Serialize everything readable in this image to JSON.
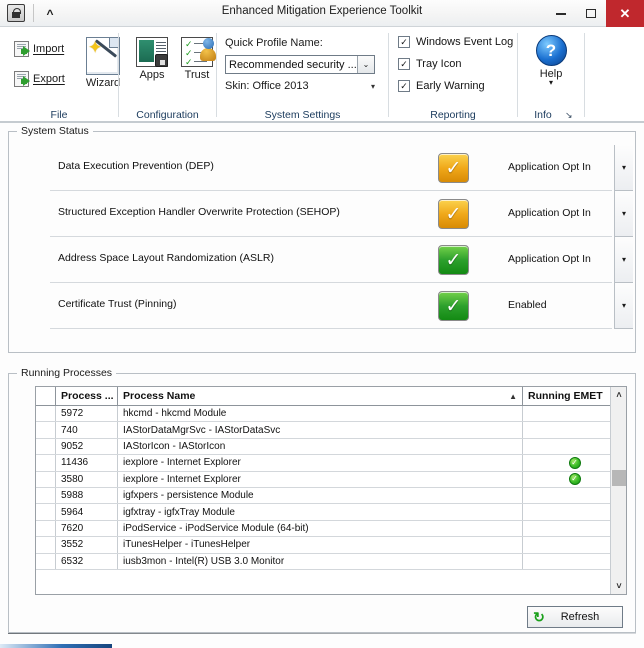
{
  "window": {
    "title": "Enhanced Mitigation Experience Toolkit",
    "app_icon": "lock-icon",
    "quick_access_caret": "^",
    "minimize": "minimize-icon",
    "maximize": "maximize-icon",
    "close": "✕"
  },
  "ribbon": {
    "groups": [
      {
        "label": "File"
      },
      {
        "label": "Configuration"
      },
      {
        "label": "System Settings"
      },
      {
        "label": "Reporting"
      },
      {
        "label": "Info"
      }
    ],
    "file": {
      "import_label": "Import",
      "export_label": "Export",
      "wizard_label": "Wizard"
    },
    "configuration": {
      "apps_label": "Apps",
      "trust_label": "Trust"
    },
    "system_settings": {
      "profile_caption": "Quick Profile Name:",
      "profile_value": "Recommended security ...",
      "profile_arrow": "⌄",
      "skin_label": "Skin: Office 2013",
      "skin_arrow": "▾"
    },
    "reporting": {
      "checkboxes": [
        {
          "label": "Windows Event Log",
          "checked": true,
          "mark": "✓"
        },
        {
          "label": "Tray Icon",
          "checked": true,
          "mark": "✓"
        },
        {
          "label": "Early Warning",
          "checked": true,
          "mark": "✓"
        }
      ]
    },
    "info": {
      "help_label": "Help",
      "help_glyph": "?",
      "help_dropdown": "▾",
      "dialog_launcher": "↘"
    }
  },
  "system_status": {
    "caption": "System Status",
    "rows": [
      {
        "name": "Data Execution Prevention (DEP)",
        "value": "Application Opt In",
        "icon": "check-amber-icon",
        "icon_color": "#f0a81a",
        "dropdown": "▾"
      },
      {
        "name": "Structured Exception Handler Overwrite Protection (SEHOP)",
        "value": "Application Opt In",
        "icon": "check-amber-icon",
        "icon_color": "#f0a81a",
        "dropdown": "▾"
      },
      {
        "name": "Address Space Layout Randomization (ASLR)",
        "value": "Application Opt In",
        "icon": "check-green-icon",
        "icon_color": "#2da02d",
        "dropdown": "▾"
      },
      {
        "name": "Certificate Trust (Pinning)",
        "value": "Enabled",
        "icon": "check-green-icon",
        "icon_color": "#2da02d",
        "dropdown": "▾"
      }
    ]
  },
  "running_processes": {
    "caption": "Running Processes",
    "columns": {
      "pid": "Process ...",
      "name": "Process Name",
      "emet": "Running EMET",
      "sort_indicator": "▲"
    },
    "rows": [
      {
        "pid": "5972",
        "name": "hkcmd - hkcmd Module",
        "emet": false
      },
      {
        "pid": "740",
        "name": "IAStorDataMgrSvc - IAStorDataSvc",
        "emet": false
      },
      {
        "pid": "9052",
        "name": "IAStorIcon - IAStorIcon",
        "emet": false
      },
      {
        "pid": "11436",
        "name": "iexplore - Internet Explorer",
        "emet": true
      },
      {
        "pid": "3580",
        "name": "iexplore - Internet Explorer",
        "emet": true
      },
      {
        "pid": "5988",
        "name": "igfxpers - persistence Module",
        "emet": false
      },
      {
        "pid": "5964",
        "name": "igfxtray - igfxTray Module",
        "emet": false
      },
      {
        "pid": "7620",
        "name": "iPodService - iPodService Module (64-bit)",
        "emet": false
      },
      {
        "pid": "3552",
        "name": "iTunesHelper - iTunesHelper",
        "emet": false
      },
      {
        "pid": "6532",
        "name": "iusb3mon - Intel(R) USB 3.0 Monitor",
        "emet": false
      }
    ],
    "emet_mark": "✓",
    "scrollbar": {
      "up": "˄",
      "down": "˅"
    },
    "refresh": {
      "label": "Refresh",
      "glyph": "↻"
    }
  }
}
